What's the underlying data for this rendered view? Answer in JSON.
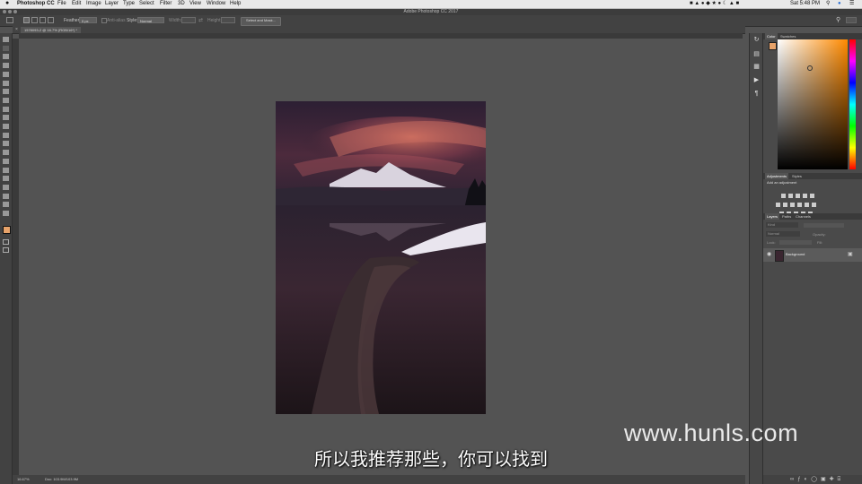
{
  "menubar": {
    "apple": "",
    "items": [
      "Photoshop CC",
      "File",
      "Edit",
      "Image",
      "Layer",
      "Type",
      "Select",
      "Filter",
      "3D",
      "View",
      "Window",
      "Help"
    ],
    "clock": "Sat 5:48 PM"
  },
  "window": {
    "title": "Adobe Photoshop CC 2017"
  },
  "options": {
    "feather_label": "Feather:",
    "feather_value": "0 px",
    "antialias_label": "Anti-alias",
    "style_label": "Style:",
    "style_value": "Normal",
    "width_label": "Width:",
    "height_label": "Height:",
    "select_mask_label": "Select and Mask..."
  },
  "document": {
    "tab": "1578093-2 @ 16.7% (RGB/16*) *",
    "zoom": "16.67%",
    "doc_size": "Doc: 103.9M/103.9M"
  },
  "panels": {
    "color_tabs": [
      "Color",
      "Swatches"
    ],
    "adjust_tabs": [
      "Adjustments",
      "Styles"
    ],
    "add_adjustment": "Add an adjustment",
    "layers_tabs": [
      "Layers",
      "Paths",
      "Channels"
    ],
    "kind_label": "Kind",
    "blend_mode": "Normal",
    "opacity_label": "Opacity:",
    "lock_label": "Lock:",
    "fill_label": "Fill:",
    "layer_name": "Background"
  },
  "colors": {
    "foreground": "#e8a36a",
    "background": "#ffffff",
    "picker_hue": "#ff8a00"
  },
  "overlay": {
    "subtitle": "所以我推荐那些，你可以找到",
    "watermark": "www.hunls.com"
  }
}
